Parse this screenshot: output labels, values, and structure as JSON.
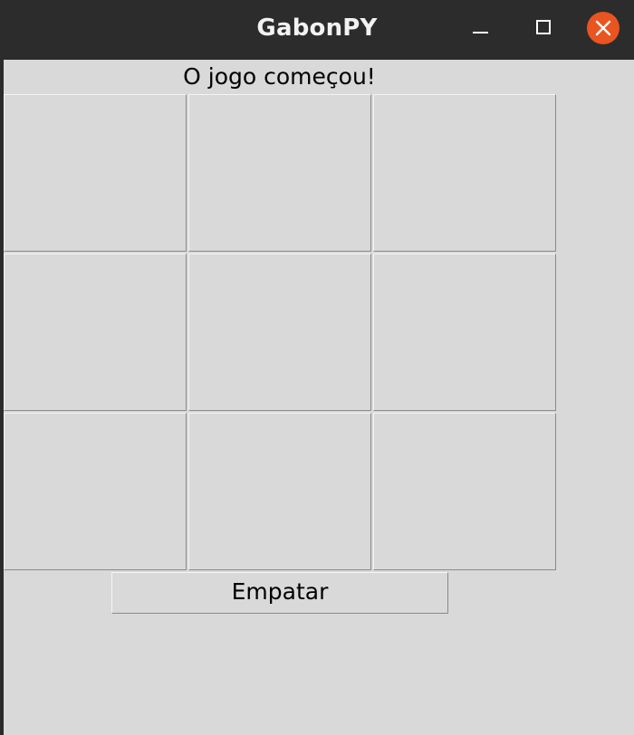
{
  "window": {
    "title": "GabonPY",
    "controls": {
      "minimize_icon": "minimize-icon",
      "maximize_icon": "maximize-icon",
      "close_icon": "close-icon",
      "close_color": "#e95420"
    }
  },
  "game": {
    "status": "O jogo começou!",
    "board": [
      [
        "",
        "",
        ""
      ],
      [
        "",
        "",
        ""
      ],
      [
        "",
        "",
        ""
      ]
    ],
    "draw_button_label": "Empatar"
  },
  "colors": {
    "titlebar": "#2c2c2c",
    "background": "#d9d9d9",
    "accent": "#e95420"
  }
}
